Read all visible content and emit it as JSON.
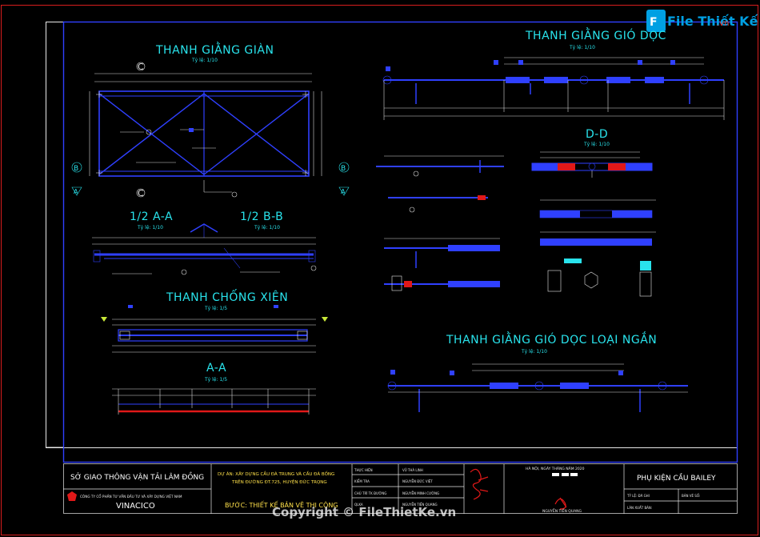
{
  "logo": {
    "text": "File Thiết Kế",
    "suffix": ".vn"
  },
  "titles": {
    "giang_gian": "THANH GIẰNG GIÀN",
    "giang_gio_doc": "THANH GIẰNG GIÓ DỌC",
    "dd": "D-D",
    "half_aa": "1/2 A-A",
    "half_bb": "1/2 B-B",
    "chong_xien": "THANH CHỐNG XIÊN",
    "aa": "A-A",
    "giang_gio_ngan": "THANH GIẰNG GIÓ DỌC LOẠI NGẮN"
  },
  "scales": {
    "s1_10": "Tỷ lệ: 1/10",
    "s1_5": "Tỷ lệ: 1/5"
  },
  "section_marks": {
    "c": "C",
    "b": "B",
    "a": "A"
  },
  "titleblock": {
    "agency": "SỞ GIAO THÔNG VẬN TẢI LÂM ĐỒNG",
    "company": "CÔNG TY CỔ PHẦN TƯ VẤN ĐẦU TƯ VÀ XÂY DỰNG VIỆT NAM",
    "company_short": "VINACICO",
    "project_line1": "DỰ ÁN: XÂY DỰNG CẦU ĐÀ TRUNG VÀ CẦU ĐÀ BỐNG",
    "project_line2": "TRÊN ĐƯỜNG ĐT.725, HUYỆN ĐỨC TRỌNG",
    "stage": "BƯỚC: THIẾT KẾ BẢN VẼ THI CÔNG",
    "roles": [
      {
        "role": "THỰC HIỆN",
        "name": "VŨ THÀ LINH"
      },
      {
        "role": "KIỂM TRA",
        "name": "NGUYỄN ĐỨC VIỆT"
      },
      {
        "role": "CHỦ TRÌ TK ĐƯỜNG",
        "name": "NGUYỄN MINH CƯỜNG"
      },
      {
        "role": "QLKA",
        "name": "NGUYỄN TIẾN QUANG"
      }
    ],
    "date_line": "HÀ NỘI, NGÀY  THÁNG  NĂM 2020",
    "director": "NGUYỄN TIẾN QUANG",
    "drawing_title": "PHỤ KIỆN CẦU BAILEY",
    "scale_label": "TỶ LỆ: ĐÃ GHI",
    "sheet_label": "BẢN VẼ SỐ:",
    "date_label": "LÀN XUẤT BẢN:"
  },
  "copyright": "Copyright © FileThietKe.vn",
  "colors": {
    "background": "#000000",
    "frame": "#e8e8e8",
    "outer_frame": "#d81e1e",
    "title_cyan": "#29e3ec",
    "member_blue": "#2f40ff",
    "member_red": "#e01818",
    "dim_white": "#d8d8d8"
  }
}
